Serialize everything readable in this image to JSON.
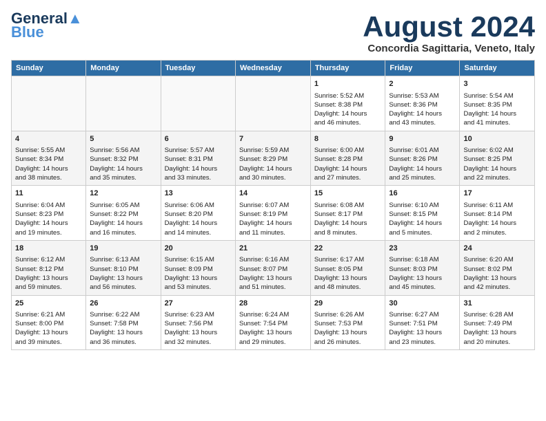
{
  "header": {
    "logo_line1": "General",
    "logo_line2": "Blue",
    "month_title": "August 2024",
    "location": "Concordia Sagittaria, Veneto, Italy"
  },
  "weekdays": [
    "Sunday",
    "Monday",
    "Tuesday",
    "Wednesday",
    "Thursday",
    "Friday",
    "Saturday"
  ],
  "weeks": [
    [
      {
        "day": "",
        "info": ""
      },
      {
        "day": "",
        "info": ""
      },
      {
        "day": "",
        "info": ""
      },
      {
        "day": "",
        "info": ""
      },
      {
        "day": "1",
        "info": "Sunrise: 5:52 AM\nSunset: 8:38 PM\nDaylight: 14 hours\nand 46 minutes."
      },
      {
        "day": "2",
        "info": "Sunrise: 5:53 AM\nSunset: 8:36 PM\nDaylight: 14 hours\nand 43 minutes."
      },
      {
        "day": "3",
        "info": "Sunrise: 5:54 AM\nSunset: 8:35 PM\nDaylight: 14 hours\nand 41 minutes."
      }
    ],
    [
      {
        "day": "4",
        "info": "Sunrise: 5:55 AM\nSunset: 8:34 PM\nDaylight: 14 hours\nand 38 minutes."
      },
      {
        "day": "5",
        "info": "Sunrise: 5:56 AM\nSunset: 8:32 PM\nDaylight: 14 hours\nand 35 minutes."
      },
      {
        "day": "6",
        "info": "Sunrise: 5:57 AM\nSunset: 8:31 PM\nDaylight: 14 hours\nand 33 minutes."
      },
      {
        "day": "7",
        "info": "Sunrise: 5:59 AM\nSunset: 8:29 PM\nDaylight: 14 hours\nand 30 minutes."
      },
      {
        "day": "8",
        "info": "Sunrise: 6:00 AM\nSunset: 8:28 PM\nDaylight: 14 hours\nand 27 minutes."
      },
      {
        "day": "9",
        "info": "Sunrise: 6:01 AM\nSunset: 8:26 PM\nDaylight: 14 hours\nand 25 minutes."
      },
      {
        "day": "10",
        "info": "Sunrise: 6:02 AM\nSunset: 8:25 PM\nDaylight: 14 hours\nand 22 minutes."
      }
    ],
    [
      {
        "day": "11",
        "info": "Sunrise: 6:04 AM\nSunset: 8:23 PM\nDaylight: 14 hours\nand 19 minutes."
      },
      {
        "day": "12",
        "info": "Sunrise: 6:05 AM\nSunset: 8:22 PM\nDaylight: 14 hours\nand 16 minutes."
      },
      {
        "day": "13",
        "info": "Sunrise: 6:06 AM\nSunset: 8:20 PM\nDaylight: 14 hours\nand 14 minutes."
      },
      {
        "day": "14",
        "info": "Sunrise: 6:07 AM\nSunset: 8:19 PM\nDaylight: 14 hours\nand 11 minutes."
      },
      {
        "day": "15",
        "info": "Sunrise: 6:08 AM\nSunset: 8:17 PM\nDaylight: 14 hours\nand 8 minutes."
      },
      {
        "day": "16",
        "info": "Sunrise: 6:10 AM\nSunset: 8:15 PM\nDaylight: 14 hours\nand 5 minutes."
      },
      {
        "day": "17",
        "info": "Sunrise: 6:11 AM\nSunset: 8:14 PM\nDaylight: 14 hours\nand 2 minutes."
      }
    ],
    [
      {
        "day": "18",
        "info": "Sunrise: 6:12 AM\nSunset: 8:12 PM\nDaylight: 13 hours\nand 59 minutes."
      },
      {
        "day": "19",
        "info": "Sunrise: 6:13 AM\nSunset: 8:10 PM\nDaylight: 13 hours\nand 56 minutes."
      },
      {
        "day": "20",
        "info": "Sunrise: 6:15 AM\nSunset: 8:09 PM\nDaylight: 13 hours\nand 53 minutes."
      },
      {
        "day": "21",
        "info": "Sunrise: 6:16 AM\nSunset: 8:07 PM\nDaylight: 13 hours\nand 51 minutes."
      },
      {
        "day": "22",
        "info": "Sunrise: 6:17 AM\nSunset: 8:05 PM\nDaylight: 13 hours\nand 48 minutes."
      },
      {
        "day": "23",
        "info": "Sunrise: 6:18 AM\nSunset: 8:03 PM\nDaylight: 13 hours\nand 45 minutes."
      },
      {
        "day": "24",
        "info": "Sunrise: 6:20 AM\nSunset: 8:02 PM\nDaylight: 13 hours\nand 42 minutes."
      }
    ],
    [
      {
        "day": "25",
        "info": "Sunrise: 6:21 AM\nSunset: 8:00 PM\nDaylight: 13 hours\nand 39 minutes."
      },
      {
        "day": "26",
        "info": "Sunrise: 6:22 AM\nSunset: 7:58 PM\nDaylight: 13 hours\nand 36 minutes."
      },
      {
        "day": "27",
        "info": "Sunrise: 6:23 AM\nSunset: 7:56 PM\nDaylight: 13 hours\nand 32 minutes."
      },
      {
        "day": "28",
        "info": "Sunrise: 6:24 AM\nSunset: 7:54 PM\nDaylight: 13 hours\nand 29 minutes."
      },
      {
        "day": "29",
        "info": "Sunrise: 6:26 AM\nSunset: 7:53 PM\nDaylight: 13 hours\nand 26 minutes."
      },
      {
        "day": "30",
        "info": "Sunrise: 6:27 AM\nSunset: 7:51 PM\nDaylight: 13 hours\nand 23 minutes."
      },
      {
        "day": "31",
        "info": "Sunrise: 6:28 AM\nSunset: 7:49 PM\nDaylight: 13 hours\nand 20 minutes."
      }
    ]
  ]
}
